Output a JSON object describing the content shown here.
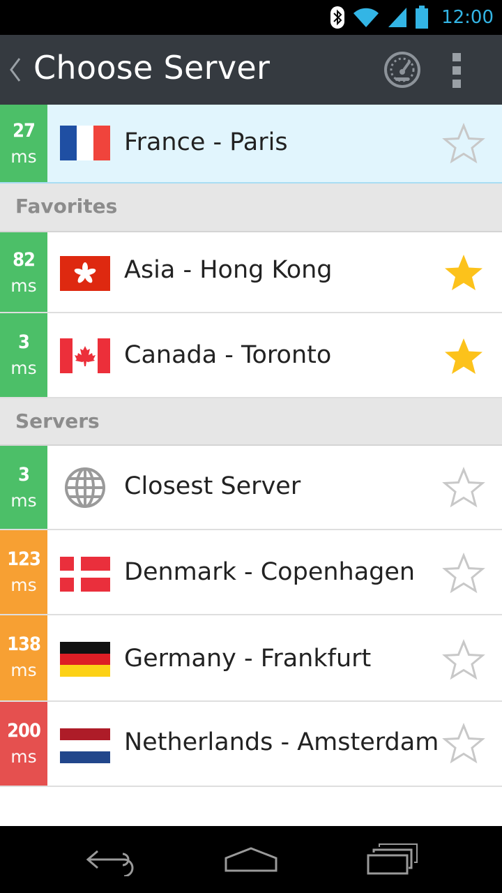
{
  "status_bar": {
    "time": "12:00"
  },
  "action_bar": {
    "title": "Choose Server"
  },
  "colors": {
    "green": "#4cbf68",
    "orange": "#f7a033",
    "red": "#e5504f",
    "star_on": "#fcc21b",
    "star_off": "#c8c8c8",
    "accent": "#33b5e5"
  },
  "current": {
    "ping": "27",
    "unit": "ms",
    "name": "France - Paris",
    "flag": "france-flag",
    "favorite": false
  },
  "sections": {
    "favorites": "Favorites",
    "servers": "Servers"
  },
  "favorites": [
    {
      "ping": "82",
      "unit": "ms",
      "name": "Asia - Hong Kong",
      "flag": "hong-kong-flag",
      "favorite": true
    },
    {
      "ping": "3",
      "unit": "ms",
      "name": "Canada - Toronto",
      "flag": "canada-flag",
      "favorite": true
    }
  ],
  "servers": [
    {
      "ping": "3",
      "unit": "ms",
      "name": "Closest Server",
      "flag": "globe-icon",
      "favorite": false
    },
    {
      "ping": "123",
      "unit": "ms",
      "name": "Denmark - Copenhagen",
      "flag": "denmark-flag",
      "favorite": false
    },
    {
      "ping": "138",
      "unit": "ms",
      "name": "Germany - Frankfurt",
      "flag": "germany-flag",
      "favorite": false
    },
    {
      "ping": "200",
      "unit": "ms",
      "name": "Netherlands - Amsterdam",
      "flag": "netherlands-flag",
      "favorite": false
    }
  ]
}
